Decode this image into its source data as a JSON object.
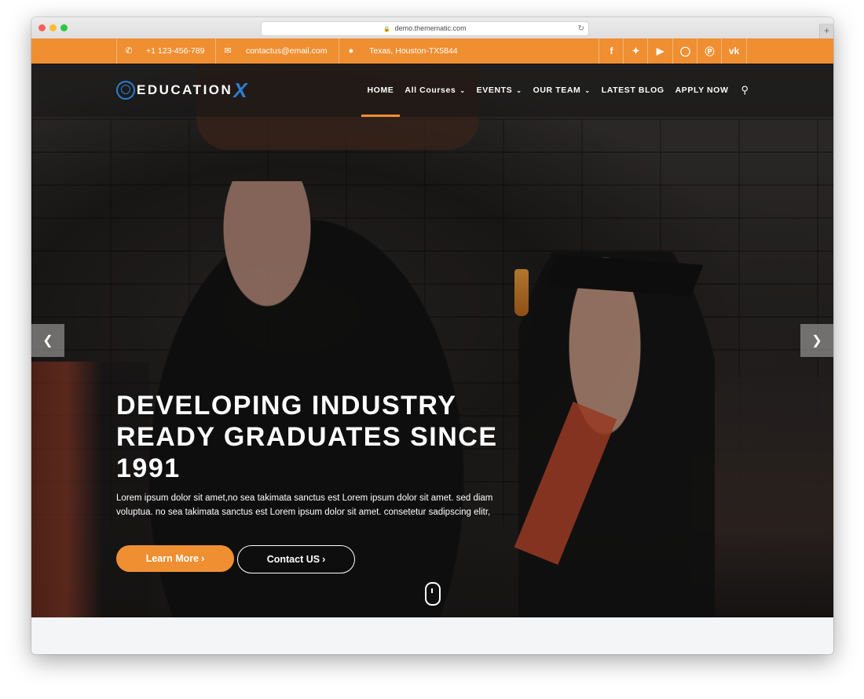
{
  "browser": {
    "url": "demo.themematic.com",
    "new_tab": "+"
  },
  "topbar": {
    "phone": "+1 123-456-789",
    "email": "contactus@email.com",
    "address": "Texas, Houston-TX5844",
    "social": [
      "f",
      "t",
      "yt",
      "ig",
      "p",
      "vk"
    ]
  },
  "brand": {
    "logo_text": "EDUCATION",
    "logo_accent": "X"
  },
  "nav": {
    "items": [
      {
        "label": "HOME",
        "active": true
      },
      {
        "label": "All Courses",
        "dropdown": true
      },
      {
        "label": "EVENTS",
        "dropdown": true
      },
      {
        "label": "OUR TEAM",
        "dropdown": true
      },
      {
        "label": "LATEST BLOG"
      },
      {
        "label": "APPLY NOW"
      }
    ]
  },
  "hero": {
    "headline": "DEVELOPING INDUSTRY READY GRADUATES SINCE 1991",
    "description": "Lorem ipsum dolor sit amet,no sea takimata sanctus est Lorem ipsum dolor sit amet. sed diam voluptua. no sea takimata sanctus est Lorem ipsum dolor sit amet. consetetur sadipscing elitr,",
    "primary_button": "Learn More",
    "secondary_button": "Contact US"
  },
  "colors": {
    "accent": "#ef8f31",
    "logo_blue": "#2d7dd2"
  }
}
